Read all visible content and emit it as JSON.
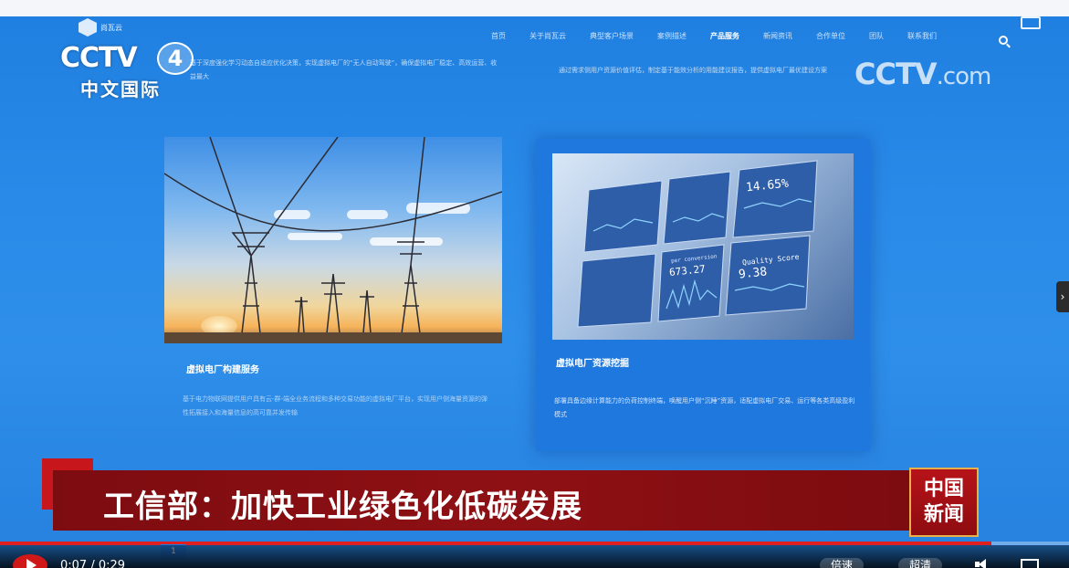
{
  "site": {
    "logo_text": "尚瓦云",
    "nav": [
      {
        "label": "首页"
      },
      {
        "label": "关于尚瓦云"
      },
      {
        "label": "典型客户场景"
      },
      {
        "label": "案例描述"
      },
      {
        "label": "产品服务",
        "active": true
      },
      {
        "label": "新闻资讯"
      },
      {
        "label": "合作单位"
      },
      {
        "label": "团队"
      },
      {
        "label": "联系我们"
      }
    ],
    "intro_left": "基于深度强化学习动态自适应优化决策，实现虚拟电厂的“无人自动驾驶”，确保虚拟电厂稳定、高效运营、收益最大",
    "intro_right": "通过需求侧用户资源价值评估，制定基于能效分析的用能建议报告，提供虚拟电厂最优建设方案",
    "cards": [
      {
        "title": "虚拟电厂构建服务",
        "desc": "基于电力物联网提供用户具有云-群-端全业务流程和多种交易功能的虚拟电厂平台，实现用户侧海量资源的弹性拓展接入和海量信息的高可靠并发传输"
      },
      {
        "title": "虚拟电厂资源挖掘",
        "desc": "部署具备边缘计算能力的负荷控制终端，唤醒用户侧“沉睡”资源，适配虚拟电厂交易、运行等各类高级盈利模式"
      }
    ],
    "dashboard": {
      "percent": "14.65%",
      "score_label": "Quality Score",
      "score_value": "9.38",
      "metric_value": "673.27",
      "metric_label": "per conversion"
    }
  },
  "broadcast": {
    "channel_logo": "CCTV",
    "channel_number": "4",
    "channel_name": "中文国际",
    "watermark_main": "CCTV",
    "watermark_suffix": ".com",
    "headline": "工信部：加快工业绿色化低碳发展",
    "news_logo_line1": "中国",
    "news_logo_line2": "新闻"
  },
  "player": {
    "time": "0:07 / 0:29",
    "progress": 0.927,
    "speed_label": "倍速",
    "quality_label": "超清",
    "page_marker": "1"
  },
  "colors": {
    "page_blue": "#2a8ae8",
    "headline_red": "#8e1014",
    "accent_red": "#c8161d",
    "play_red": "#d01818"
  }
}
